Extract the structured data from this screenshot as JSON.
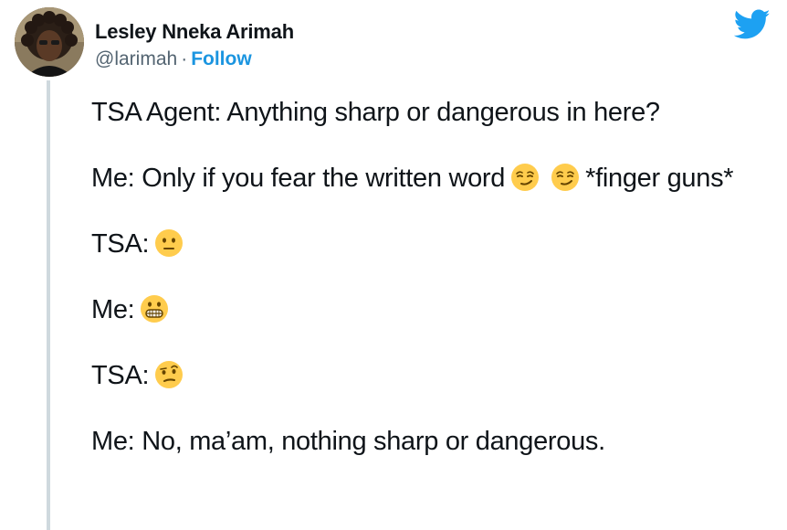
{
  "author": {
    "name": "Lesley Nneka Arimah",
    "handle": "@larimah",
    "separator": "·",
    "follow_label": "Follow",
    "avatar_icon": "profile-photo",
    "verified": false
  },
  "brand": {
    "icon": "twitter-bird-icon",
    "color": "#1da1f2",
    "link_color": "#1b95e0"
  },
  "tweet": {
    "lines": [
      {
        "speaker": "TSA Agent:",
        "text": "Anything sharp or dangerous in here?"
      },
      {
        "speaker": "Me:",
        "text": "Only if you fear the written word",
        "emojis": [
          "smirking-face",
          "smirking-face"
        ],
        "after": "*finger guns*"
      },
      {
        "speaker": "TSA:",
        "emojis": [
          "neutral-face"
        ]
      },
      {
        "speaker": "Me:",
        "emojis": [
          "grimacing-face"
        ]
      },
      {
        "speaker": "TSA:",
        "emojis": [
          "face-with-raised-eyebrow"
        ]
      },
      {
        "speaker": "Me:",
        "text": "No, ma’am, nothing sharp or dangerous."
      }
    ]
  }
}
